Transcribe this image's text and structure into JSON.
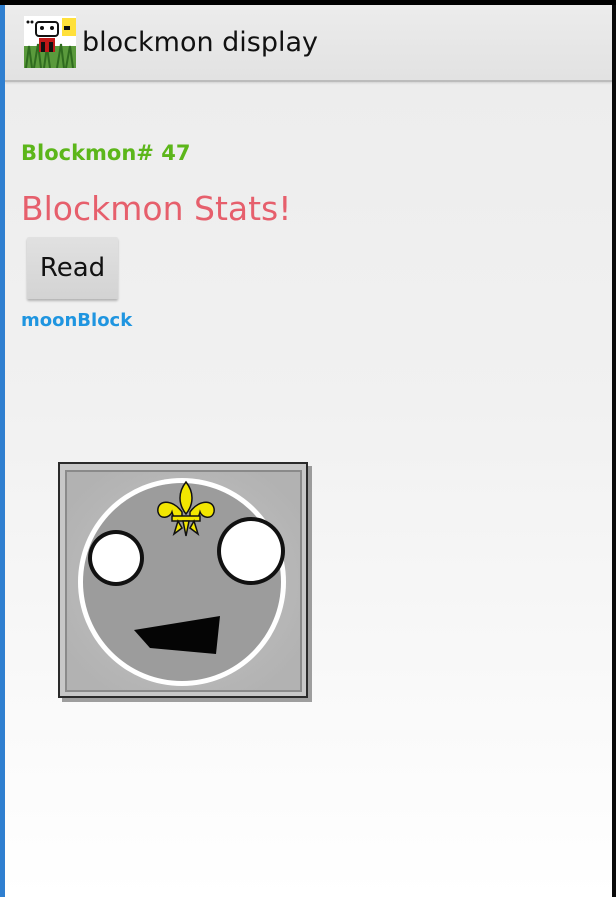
{
  "action_bar": {
    "title": "blockmon display",
    "icon": "blockmon-app-icon"
  },
  "content": {
    "blockmon_number": "Blockmon# 47",
    "stats_heading": "Blockmon Stats!",
    "read_button_label": "Read",
    "block_name": "moonBlock"
  },
  "image": {
    "subject": "moonblock-face",
    "crest": "fleur-de-lis-icon"
  },
  "colors": {
    "number_green": "#5cb61a",
    "heading_pink": "#e65f6c",
    "name_blue": "#1f95e0",
    "crest_yellow": "#f2e600",
    "border_blue": "#2f7fd0"
  }
}
